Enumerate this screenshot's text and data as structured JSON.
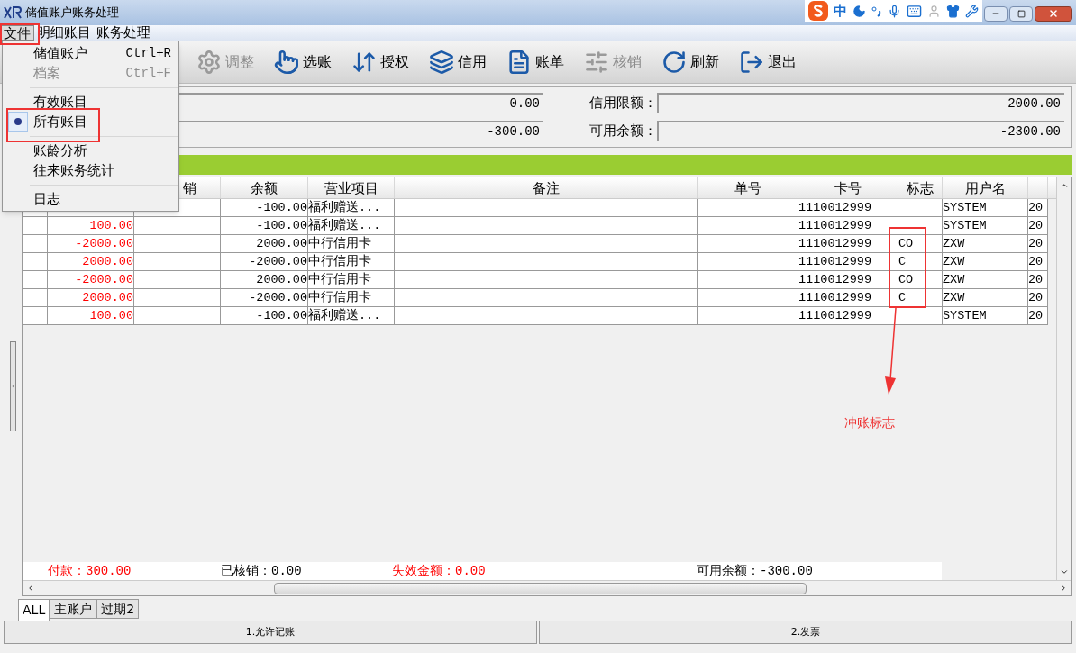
{
  "window": {
    "title": "储值账户账务处理"
  },
  "ime_bar": {
    "mode": "中"
  },
  "menubar": [
    {
      "label": "文件",
      "selected": true
    },
    {
      "label": "明细账目",
      "selected": false
    },
    {
      "label": "账务处理",
      "selected": false
    }
  ],
  "menu": {
    "groups": [
      [
        {
          "label": "储值账户",
          "shortcut": "Ctrl+R",
          "disabled": false,
          "checked": false
        },
        {
          "label": "档案",
          "shortcut": "Ctrl+F",
          "disabled": true,
          "checked": false
        }
      ],
      [
        {
          "label": "有效账目",
          "disabled": false,
          "checked": false
        },
        {
          "label": "所有账目",
          "disabled": false,
          "checked": true
        }
      ],
      [
        {
          "label": "账龄分析",
          "disabled": false,
          "checked": false
        },
        {
          "label": "往来账务统计",
          "disabled": false,
          "checked": false
        }
      ],
      [
        {
          "label": "日志",
          "disabled": false,
          "checked": false
        }
      ]
    ]
  },
  "toolbar": [
    {
      "label": "调整",
      "kind": "gear",
      "disabled": true
    },
    {
      "label": "选账",
      "kind": "hand",
      "disabled": false
    },
    {
      "label": "授权",
      "kind": "arrows",
      "disabled": false
    },
    {
      "label": "信用",
      "kind": "stack",
      "disabled": false
    },
    {
      "label": "账单",
      "kind": "bill",
      "disabled": false
    },
    {
      "label": "核销",
      "kind": "sliders",
      "disabled": true
    },
    {
      "label": "刷新",
      "kind": "refresh",
      "disabled": false
    },
    {
      "label": "退出",
      "kind": "exit",
      "disabled": false
    }
  ],
  "info": {
    "left_values": [
      "0.00",
      "-300.00"
    ],
    "right_fields": [
      {
        "label": "信用限额：",
        "value": "2000.00"
      },
      {
        "label": "可用余额：",
        "value": "-2300.00"
      }
    ]
  },
  "table": {
    "columns": [
      null,
      null,
      "销",
      "余额",
      "营业项目",
      "备注",
      "单号",
      "卡号",
      "标志",
      "用户名",
      null
    ],
    "rows": [
      [
        null,
        null,
        null,
        "-100.00",
        "福利赠送...",
        null,
        null,
        "1110012999",
        null,
        "SYSTEM",
        "20"
      ],
      [
        null,
        "100.00",
        null,
        "-100.00",
        "福利赠送...",
        null,
        null,
        "1110012999",
        null,
        "SYSTEM",
        "20"
      ],
      [
        null,
        "-2000.00",
        null,
        "2000.00",
        "中行信用卡",
        null,
        null,
        "1110012999",
        "CO",
        "ZXW",
        "20"
      ],
      [
        null,
        "2000.00",
        null,
        "-2000.00",
        "中行信用卡",
        null,
        null,
        "1110012999",
        "C",
        "ZXW",
        "20"
      ],
      [
        null,
        "-2000.00",
        null,
        "2000.00",
        "中行信用卡",
        null,
        null,
        "1110012999",
        "CO",
        "ZXW",
        "20"
      ],
      [
        null,
        "2000.00",
        null,
        "-2000.00",
        "中行信用卡",
        null,
        null,
        "1110012999",
        "C",
        "ZXW",
        "20"
      ],
      [
        null,
        "100.00",
        null,
        "-100.00",
        "福利赠送...",
        null,
        null,
        "1110012999",
        null,
        "SYSTEM",
        "20"
      ]
    ]
  },
  "summary": [
    {
      "text": "付款：300.00",
      "color": "#ff0000"
    },
    {
      "text": "已核销：0.00",
      "color": "#000000"
    },
    {
      "text": "失效金额：0.00",
      "color": "#ff0000"
    },
    {
      "text": "可用余额：-300.00",
      "color": "#000000"
    }
  ],
  "tabs": [
    {
      "label": "ALL",
      "selected": true
    },
    {
      "label": "主账户",
      "selected": false
    },
    {
      "label": "过期2",
      "selected": false
    }
  ],
  "status_bar": [
    "1.允许记账",
    "2.发票"
  ],
  "annotation": {
    "text": "冲账标志"
  }
}
